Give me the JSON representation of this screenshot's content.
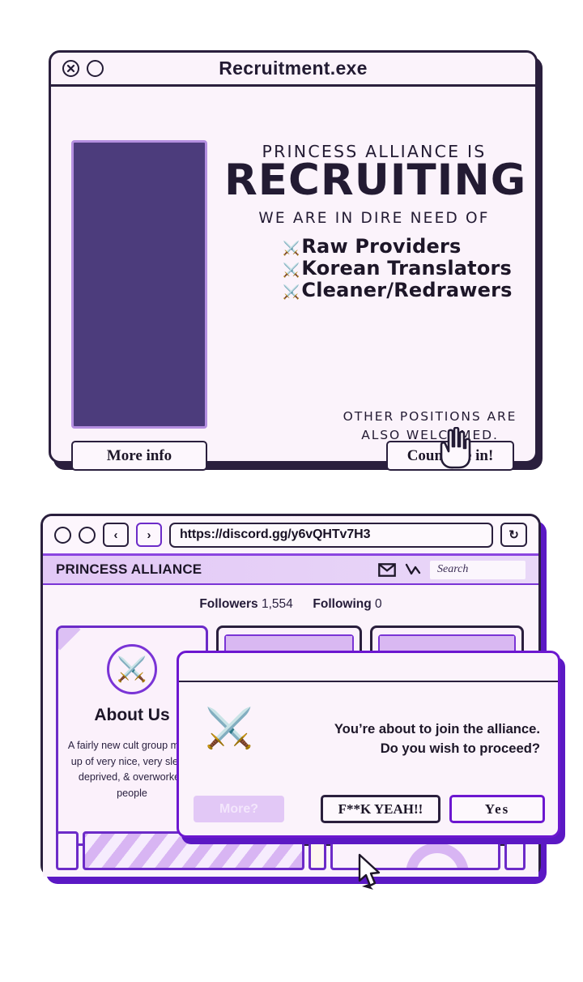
{
  "colors": {
    "ink": "#231b33",
    "accent_purple": "#6c2bc8",
    "bright_purple": "#5b18c4",
    "panel_bg": "#fbf3fb",
    "image_placeholder": "#4c3c7c",
    "lavender": "#e2c8f6"
  },
  "window1": {
    "title": "Recruitment.exe",
    "controls": [
      {
        "name": "close",
        "icon": "close-circle-icon"
      },
      {
        "name": "maximize",
        "icon": "circle-icon"
      }
    ],
    "hero": {
      "eyebrow": "PRINCESS ALLIANCE IS",
      "headline": "RECRUITING",
      "subhead": "WE ARE IN DIRE NEED OF"
    },
    "needs": [
      {
        "bullet": "⚔️",
        "label": "Raw Providers"
      },
      {
        "bullet": "⚔️",
        "label": "Korean Translators"
      },
      {
        "bullet": "⚔️",
        "label": "Cleaner/Redrawers"
      }
    ],
    "footnote_line1": "OTHER POSITIONS ARE",
    "footnote_line2": "ALSO WELCOMED.",
    "buttons": {
      "more_info": "More info",
      "count_me_in": "Count me in!"
    }
  },
  "window2": {
    "nav": {
      "back_icon": "chevron-left-icon",
      "back_label": "‹",
      "forward_icon": "chevron-right-icon",
      "forward_label": "›",
      "url": "https://discord.gg/y6vQHTv7H3",
      "reload_icon": "reload-icon",
      "reload_label": "↻"
    },
    "sitebar": {
      "brand": "PRINCESS ALLIANCE",
      "mail_icon": "envelope-icon",
      "share_icon": "arrow-zigzag-icon",
      "search_placeholder": "Search"
    },
    "stats": {
      "followers_label": "Followers",
      "followers_value": "1,554",
      "following_label": "Following",
      "following_value": "0"
    },
    "about_card": {
      "avatar_icon": "⚔️",
      "heading": "About Us",
      "body": "A fairly new cult group made up of very nice, very sleep-deprived, & overworked people"
    }
  },
  "modal": {
    "icon": "⚔️",
    "message_line1": "You’re about to join the alliance.",
    "message_line2": "Do you wish to proceed?",
    "buttons": {
      "more": "More?",
      "confirm_loud": "F**K YEAH!!",
      "confirm": "Yes"
    }
  },
  "cursors": {
    "hand": "pointing-hand-cursor",
    "arrow": "arrow-cursor"
  }
}
